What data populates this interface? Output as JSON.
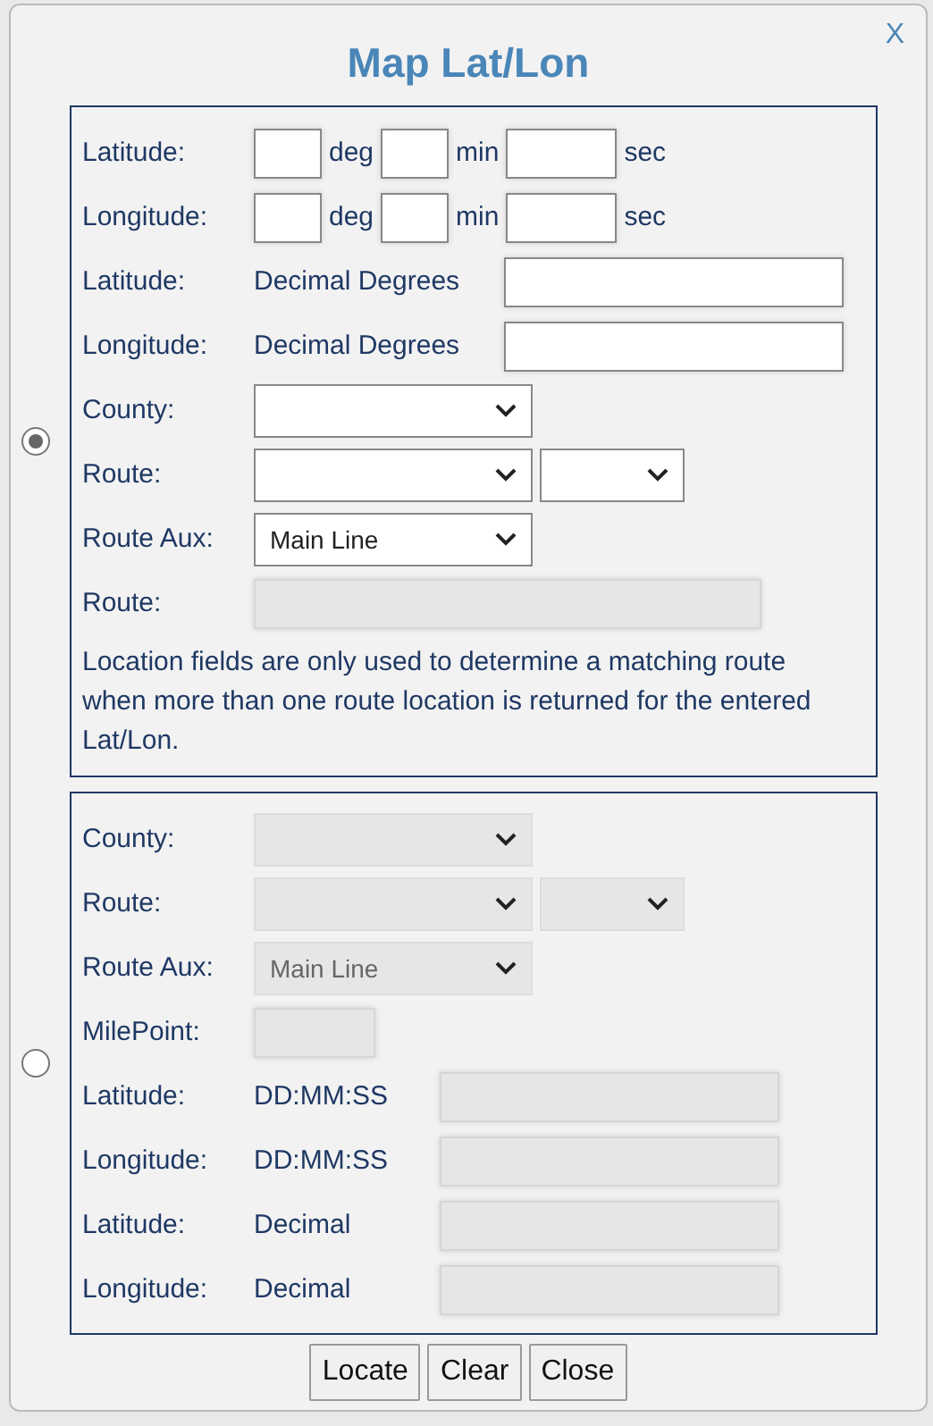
{
  "dialog": {
    "title": "Map Lat/Lon",
    "close": "X"
  },
  "sections": [
    {
      "selected": true,
      "disabled": false,
      "rows": [
        {
          "kind": "dms",
          "label": "Latitude:",
          "units": [
            "deg",
            "min",
            "sec"
          ]
        },
        {
          "kind": "dms",
          "label": "Longitude:",
          "units": [
            "deg",
            "min",
            "sec"
          ]
        },
        {
          "kind": "labeled-input",
          "label": "Latitude:",
          "sublabel": "Decimal Degrees"
        },
        {
          "kind": "labeled-input",
          "label": "Longitude:",
          "sublabel": "Decimal Degrees"
        },
        {
          "kind": "select",
          "label": "County:"
        },
        {
          "kind": "select-pair",
          "label": "Route:"
        },
        {
          "kind": "select",
          "label": "Route Aux:",
          "value": "Main Line"
        },
        {
          "kind": "text",
          "label": "Route:",
          "disabled": true
        },
        {
          "kind": "note",
          "text": "Location fields are only used to determine a matching route when more than one route location is returned for the entered Lat/Lon."
        }
      ]
    },
    {
      "selected": false,
      "disabled": true,
      "rows": [
        {
          "kind": "select",
          "label": "County:"
        },
        {
          "kind": "select-pair",
          "label": "Route:"
        },
        {
          "kind": "select",
          "label": "Route Aux:",
          "value": "Main Line"
        },
        {
          "kind": "short",
          "label": "MilePoint:"
        },
        {
          "kind": "labeled-input",
          "label": "Latitude:",
          "sublabel": "DD:MM:SS"
        },
        {
          "kind": "labeled-input",
          "label": "Longitude:",
          "sublabel": "DD:MM:SS"
        },
        {
          "kind": "labeled-input",
          "label": "Latitude:",
          "sublabel": "Decimal"
        },
        {
          "kind": "labeled-input",
          "label": "Longitude:",
          "sublabel": "Decimal"
        }
      ]
    }
  ],
  "buttons": [
    "Locate",
    "Clear",
    "Close"
  ]
}
